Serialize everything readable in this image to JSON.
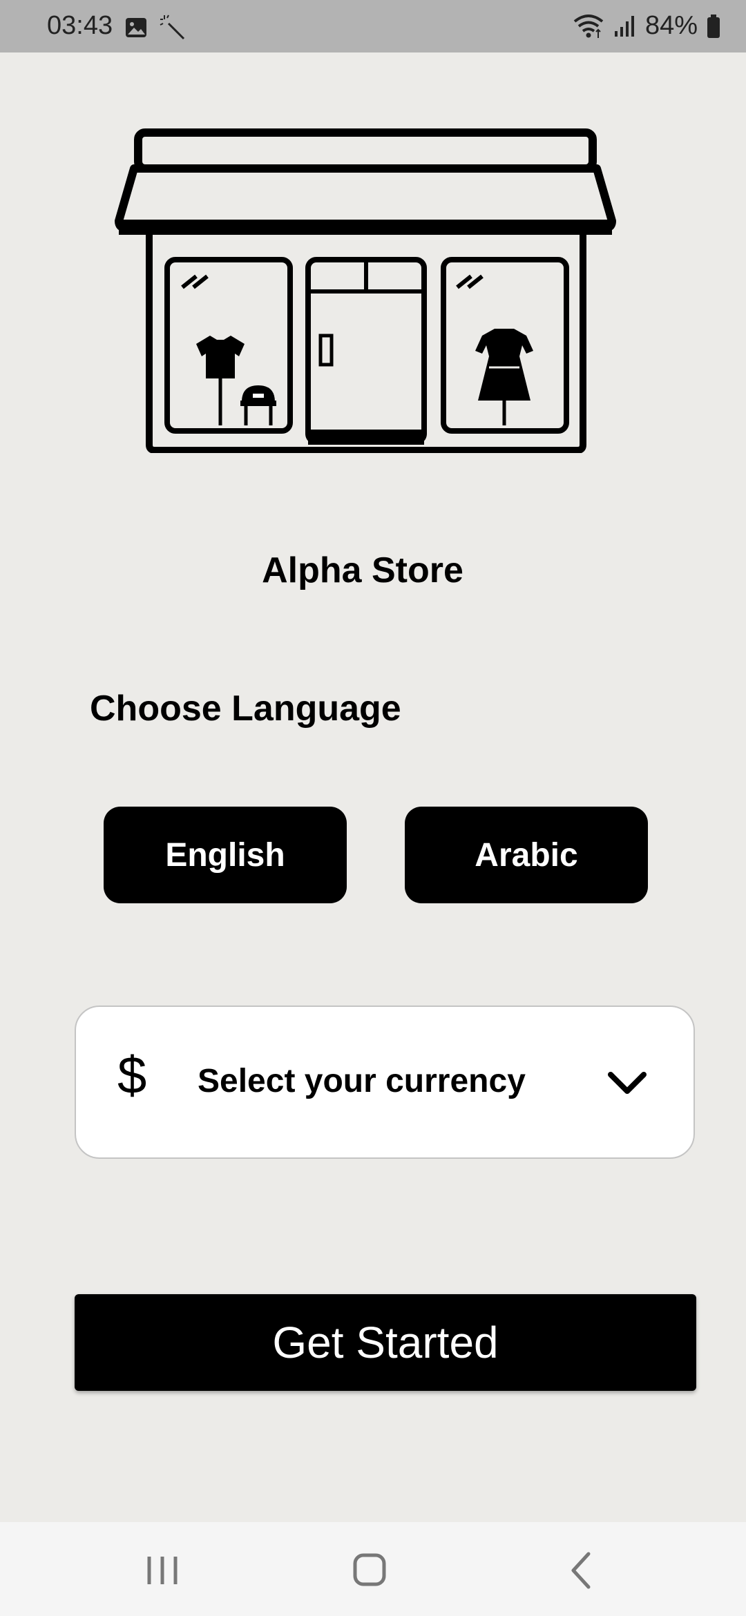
{
  "status_bar": {
    "time": "03:43",
    "battery": "84%",
    "icons": [
      "image-icon",
      "magic-wand-icon",
      "wifi-icon",
      "signal-icon",
      "battery-icon"
    ]
  },
  "app": {
    "store_name": "Alpha Store",
    "choose_language_label": "Choose Language",
    "languages": [
      "English",
      "Arabic"
    ],
    "currency": {
      "icon_symbol": "$",
      "placeholder": "Select your currency"
    },
    "get_started_label": "Get Started"
  },
  "nav_bar": {
    "buttons": [
      "recents",
      "home",
      "back"
    ]
  },
  "colors": {
    "background": "#ecebe8",
    "button": "#000000",
    "button_text": "#ffffff",
    "status_bar": "#b3b3b3",
    "nav_bar": "#f5f5f5"
  }
}
